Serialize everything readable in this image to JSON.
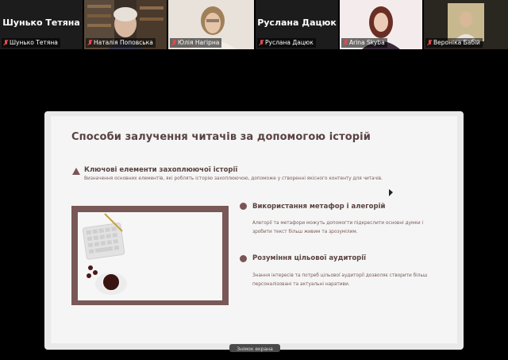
{
  "participants": [
    {
      "big_name": "Шунько Тетяна",
      "caption": "Шунько Тетяна",
      "muted": true,
      "video": false
    },
    {
      "big_name": "",
      "caption": "Наталія Поповська",
      "muted": true,
      "video": true
    },
    {
      "big_name": "",
      "caption": "Юлія Нагірна",
      "muted": true,
      "video": true,
      "active": true
    },
    {
      "big_name": "Руслана Дацюк",
      "caption": "Руслана Дацюк",
      "muted": true,
      "video": false
    },
    {
      "big_name": "",
      "caption": "Arina Skyba",
      "muted": true,
      "video": true
    },
    {
      "big_name": "",
      "caption": "Вероніка Бабій",
      "muted": true,
      "video": true
    }
  ],
  "slide": {
    "title": "Способи залучення читачів за допомогою історій",
    "section1": {
      "heading": "Ключові елементи захоплюючої історії",
      "text": "Визначення основних елементів, які роблять історію захоплюючою, допоможе у створенні якісного контенту для читачів."
    },
    "section2": {
      "heading": "Використання метафор і алегорій",
      "text": "Алегорії та метафори можуть допомогти підкреслити основні думки і зробити текст більш живим та зрозумілим."
    },
    "section3": {
      "heading": "Розуміння цільової аудиторії",
      "text": "Знання інтересів та потреб цільової аудиторії дозволяє створити більш персоналізовані та актуальні наративи."
    }
  },
  "share_tab": {
    "label": "Знімок екрана"
  },
  "colors": {
    "accent": "#7a5555",
    "title": "#5a4242",
    "active_border": "#2ecc71",
    "muted_mic": "#e8484a"
  }
}
